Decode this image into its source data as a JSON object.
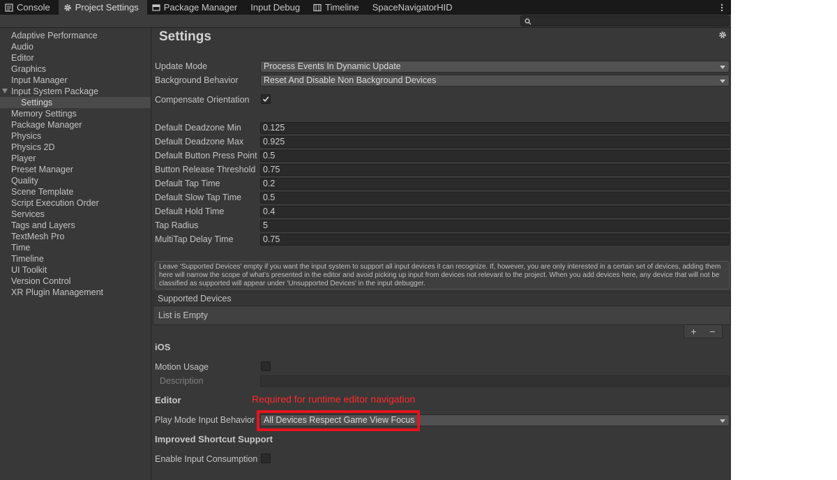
{
  "tabs": [
    {
      "label": "Console",
      "icon": "console-icon",
      "active": false
    },
    {
      "label": "Project Settings",
      "icon": "gear-icon",
      "active": true
    },
    {
      "label": "Package Manager",
      "icon": "package-icon",
      "active": false
    },
    {
      "label": "Input Debug",
      "icon": "",
      "active": false
    },
    {
      "label": "Timeline",
      "icon": "timeline-icon",
      "active": false
    },
    {
      "label": "SpaceNavigatorHID",
      "icon": "",
      "active": false
    }
  ],
  "search": {
    "value": ""
  },
  "sidebar": {
    "items": [
      {
        "label": "Adaptive Performance"
      },
      {
        "label": "Audio"
      },
      {
        "label": "Editor"
      },
      {
        "label": "Graphics"
      },
      {
        "label": "Input Manager"
      },
      {
        "label": "Input System Package"
      },
      {
        "label": "Settings"
      },
      {
        "label": "Memory Settings"
      },
      {
        "label": "Package Manager"
      },
      {
        "label": "Physics"
      },
      {
        "label": "Physics 2D"
      },
      {
        "label": "Player"
      },
      {
        "label": "Preset Manager"
      },
      {
        "label": "Quality"
      },
      {
        "label": "Scene Template"
      },
      {
        "label": "Script Execution Order"
      },
      {
        "label": "Services"
      },
      {
        "label": "Tags and Layers"
      },
      {
        "label": "TextMesh Pro"
      },
      {
        "label": "Time"
      },
      {
        "label": "Timeline"
      },
      {
        "label": "UI Toolkit"
      },
      {
        "label": "Version Control"
      },
      {
        "label": "XR Plugin Management"
      }
    ]
  },
  "main": {
    "title": "Settings",
    "update_mode": {
      "label": "Update Mode",
      "value": "Process Events In Dynamic Update"
    },
    "background_behavior": {
      "label": "Background Behavior",
      "value": "Reset And Disable Non Background Devices"
    },
    "compensate_orientation": {
      "label": "Compensate Orientation",
      "checked": true
    },
    "fields": [
      {
        "label": "Default Deadzone Min",
        "value": "0.125"
      },
      {
        "label": "Default Deadzone Max",
        "value": "0.925"
      },
      {
        "label": "Default Button Press Point",
        "value": "0.5"
      },
      {
        "label": "Button Release Threshold",
        "value": "0.75"
      },
      {
        "label": "Default Tap Time",
        "value": "0.2"
      },
      {
        "label": "Default Slow Tap Time",
        "value": "0.5"
      },
      {
        "label": "Default Hold Time",
        "value": "0.4"
      },
      {
        "label": "Tap Radius",
        "value": "5"
      },
      {
        "label": "MultiTap Delay Time",
        "value": "0.75"
      }
    ],
    "help_text": "Leave 'Supported Devices' empty if you want the input system to support all input devices it can recognize. If, however, you are only interested in a certain set of devices, adding them here will narrow the scope of what's presented in the editor and avoid picking up input from devices not relevant to the project. When you add devices here, any device that will not be classified as supported will appear under 'Unsupported Devices' in the input debugger.",
    "supported_devices": {
      "header": "Supported Devices",
      "empty_text": "List is Empty",
      "add": "+",
      "remove": "−"
    },
    "ios": {
      "heading": "iOS",
      "motion_usage": {
        "label": "Motion Usage",
        "checked": false
      },
      "description": {
        "label": "Description",
        "value": ""
      }
    },
    "editor": {
      "heading": "Editor",
      "play_mode_input_behavior": {
        "label": "Play Mode Input Behavior",
        "value": "All Devices Respect Game View Focus"
      }
    },
    "improved_shortcut": {
      "heading": "Improved Shortcut Support",
      "enable_input_consumption": {
        "label": "Enable Input Consumption",
        "checked": false
      }
    }
  },
  "annotation": {
    "text": "Required for runtime editor navigation",
    "color": "#e3141e"
  }
}
